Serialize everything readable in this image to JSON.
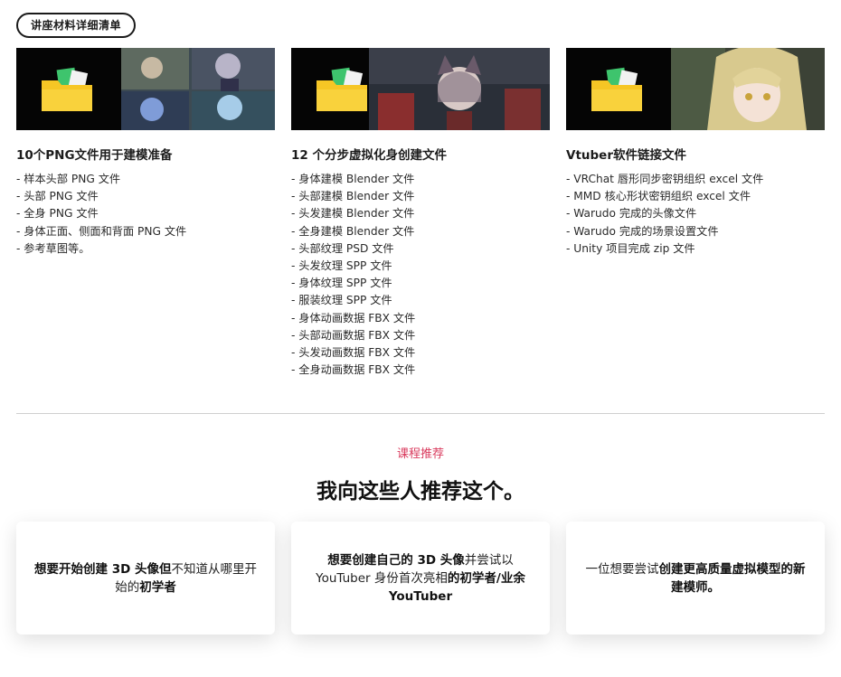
{
  "badge": "讲座材料详细清单",
  "columns": [
    {
      "title": "10个PNG文件用于建模准备",
      "items": [
        "样本头部 PNG 文件",
        "头部 PNG 文件",
        "全身 PNG 文件",
        "身体正面、侧面和背面 PNG 文件",
        "参考草图等。"
      ]
    },
    {
      "title": "12 个分步虚拟化身创建文件",
      "items": [
        "身体建模 Blender 文件",
        "头部建模 Blender 文件",
        "头发建模 Blender 文件",
        "全身建模 Blender 文件",
        "头部纹理 PSD 文件",
        "头发纹理 SPP 文件",
        "身体纹理 SPP 文件",
        "服装纹理 SPP 文件",
        "身体动画数据 FBX 文件",
        "头部动画数据 FBX 文件",
        "头发动画数据 FBX 文件",
        "全身动画数据 FBX 文件"
      ]
    },
    {
      "title": "Vtuber软件链接文件",
      "items": [
        "VRChat 唇形同步密钥组织 excel 文件",
        "MMD 核心形状密钥组织 excel 文件",
        "Warudo 完成的头像文件",
        "Warudo 完成的场景设置文件",
        "Unity 项目完成 zip 文件"
      ]
    }
  ],
  "recommend": {
    "eyebrow": "课程推荐",
    "headline": "我向这些人推荐这个。",
    "cards": [
      {
        "parts": [
          {
            "t": "想要开始创建 3D 头像但",
            "b": true
          },
          {
            "t": "不知道从哪里开始的",
            "b": false
          },
          {
            "t": "初学者",
            "b": true
          }
        ]
      },
      {
        "parts": [
          {
            "t": "想要创建自己的 3D 头像",
            "b": true
          },
          {
            "t": "并尝试以 YouTuber 身份首次亮相",
            "b": false
          },
          {
            "t": "的初学者/业余 YouTuber",
            "b": true
          }
        ]
      },
      {
        "parts": [
          {
            "t": "一位想要尝试",
            "b": false
          },
          {
            "t": "创建更高质量虚拟模型的新建模师。",
            "b": true
          }
        ]
      }
    ]
  },
  "colors": {
    "accent": "#d93a5d",
    "folder": "#f6c625",
    "file_green": "#3ec46d"
  },
  "icons": [
    "folder-icon"
  ]
}
